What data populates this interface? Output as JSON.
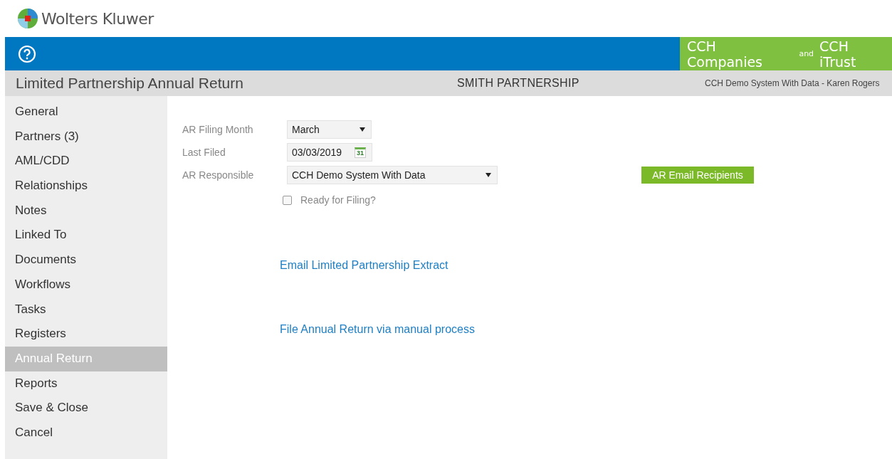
{
  "logo": {
    "text": "Wolters Kluwer"
  },
  "brand": {
    "part_1": "CCH Companies",
    "joiner": "and",
    "part_2": "CCH iTrust"
  },
  "header": {
    "title": "Limited Partnership Annual Return",
    "entity": "SMITH PARTNERSHIP",
    "user": "CCH Demo System With Data - Karen Rogers"
  },
  "sidebar": {
    "items": [
      {
        "label": "General",
        "selected": false
      },
      {
        "label": "Partners (3)",
        "selected": false
      },
      {
        "label": "AML/CDD",
        "selected": false
      },
      {
        "label": "Relationships",
        "selected": false
      },
      {
        "label": "Notes",
        "selected": false
      },
      {
        "label": "Linked To",
        "selected": false
      },
      {
        "label": "Documents",
        "selected": false
      },
      {
        "label": "Workflows",
        "selected": false
      },
      {
        "label": "Tasks",
        "selected": false
      },
      {
        "label": "Registers",
        "selected": false
      },
      {
        "label": "Annual Return",
        "selected": true
      },
      {
        "label": "Reports",
        "selected": false
      },
      {
        "label": "Save & Close",
        "selected": false
      },
      {
        "label": "Cancel",
        "selected": false
      }
    ]
  },
  "form": {
    "filing_month": {
      "label": "AR Filing Month",
      "value": "March"
    },
    "last_filed": {
      "label": "Last Filed",
      "value": "03/03/2019",
      "calendar_day": "31"
    },
    "responsible": {
      "label": "AR Responsible",
      "value": "CCH Demo System With Data"
    },
    "recipients_button": "AR Email Recipients",
    "ready": {
      "label": "Ready for Filing?",
      "checked": false
    }
  },
  "links": [
    "Email Limited Partnership Extract",
    "File Annual Return via manual process"
  ]
}
